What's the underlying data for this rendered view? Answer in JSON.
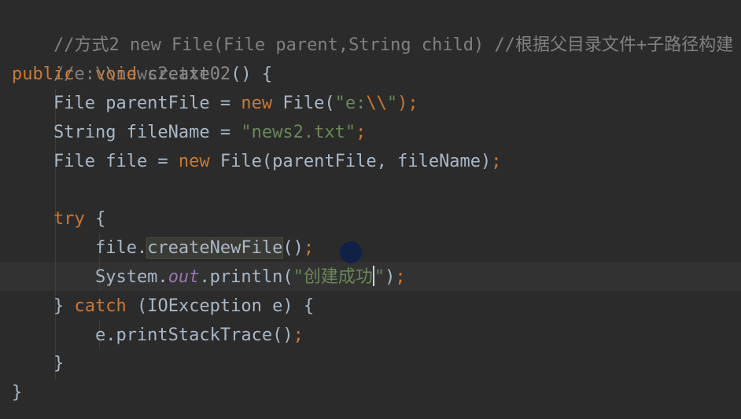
{
  "lines": [
    {
      "tokens": [
        "//方式2 new File(File parent,String child) //根据父目录文件+子路径构建"
      ]
    },
    {
      "tokens": [
        "//e:\\\\news2.txt"
      ]
    },
    {
      "tokens": [
        "public",
        "  ",
        "void",
        " ",
        "create02",
        "() {"
      ]
    },
    {
      "tokens": [
        "    File parentFile = ",
        "new",
        " File(",
        "\"e:",
        "\\\\",
        "\"",
        ");"
      ]
    },
    {
      "tokens": [
        "    String fileName = ",
        "\"news2.txt\"",
        ";"
      ]
    },
    {
      "tokens": [
        "    File file = ",
        "new",
        " File(parentFile, fileName)",
        ";"
      ]
    },
    {
      "tokens": [
        ""
      ]
    },
    {
      "tokens": [
        "    ",
        "try",
        " {"
      ]
    },
    {
      "tokens": [
        "        file.",
        "createNewFile",
        "()",
        ";"
      ]
    },
    {
      "tokens": [
        "        System.",
        "out",
        ".println(",
        "\"创建成功",
        "\"",
        ")",
        ";"
      ]
    },
    {
      "tokens": [
        "    } ",
        "catch",
        " (IOException e) {"
      ]
    },
    {
      "tokens": [
        "        e.printStackTrace()",
        ";"
      ]
    },
    {
      "tokens": [
        "    }"
      ]
    },
    {
      "tokens": [
        "}"
      ]
    }
  ]
}
